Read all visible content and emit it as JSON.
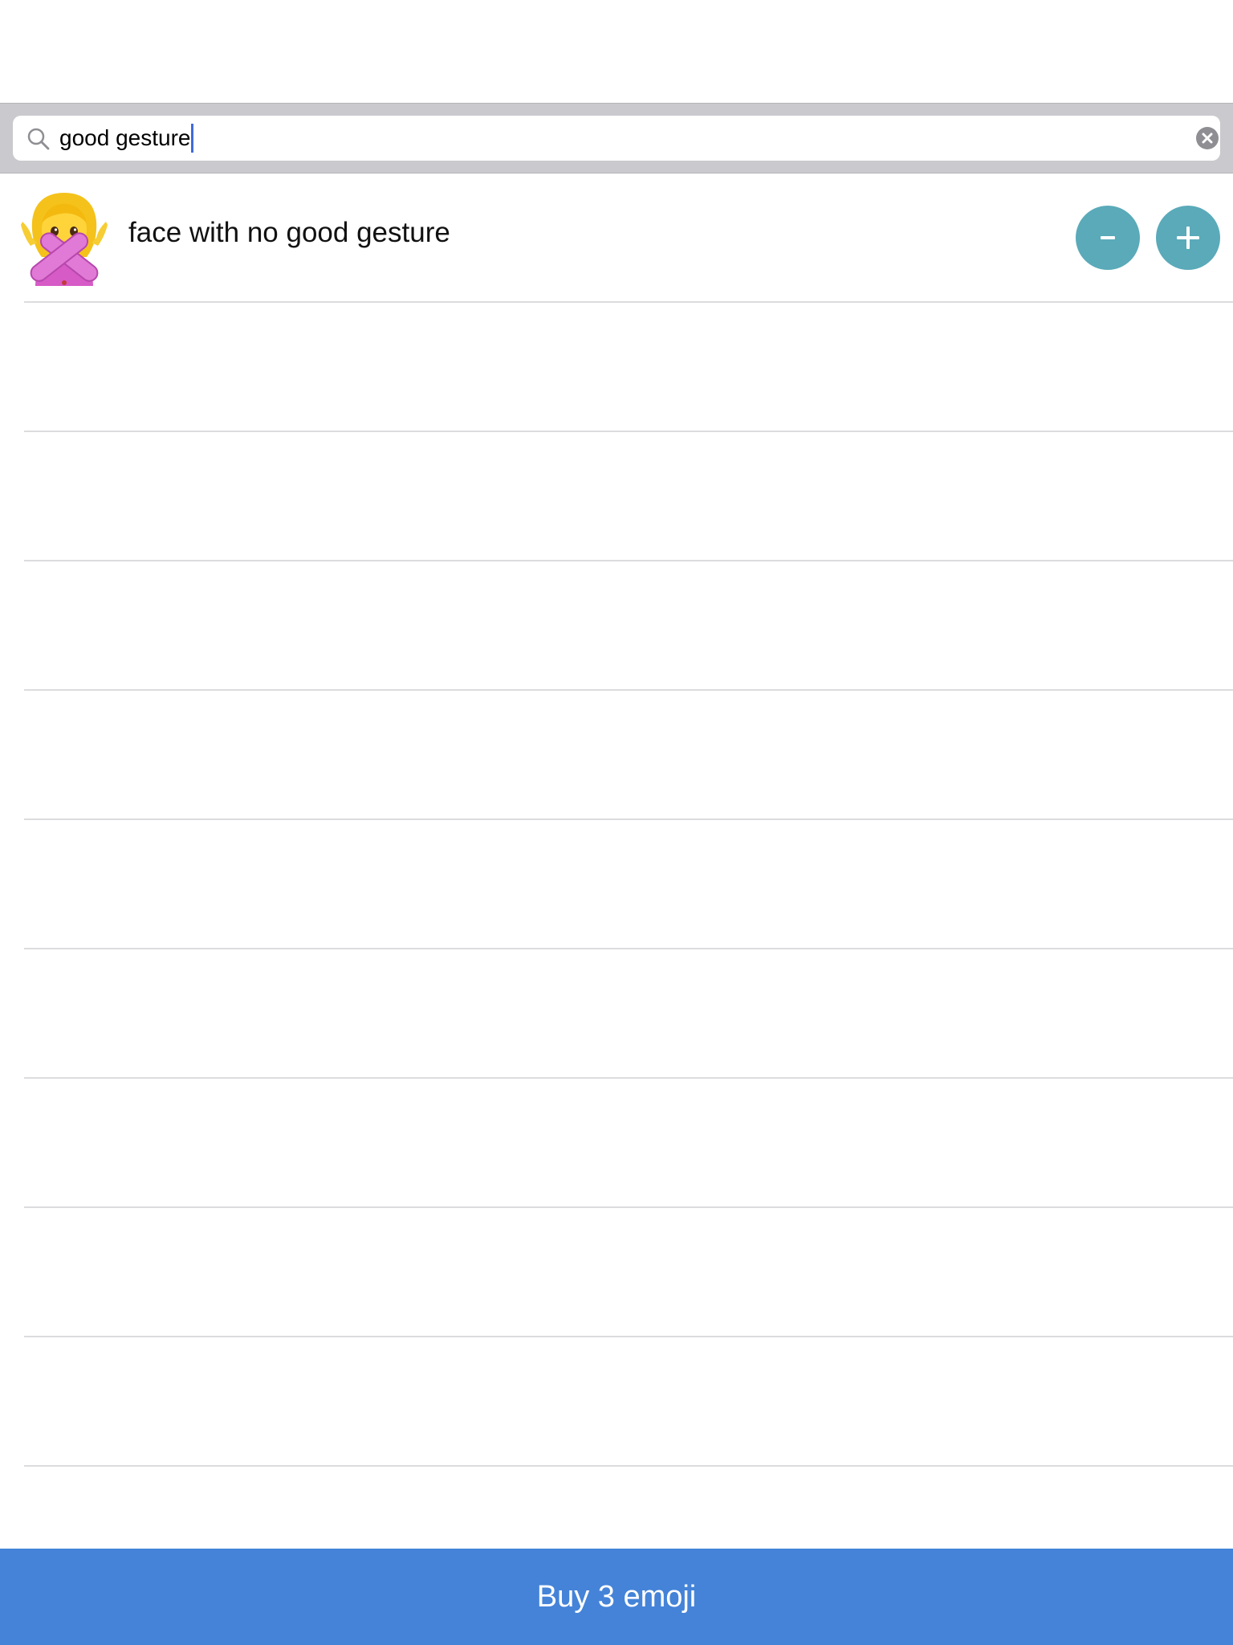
{
  "search": {
    "query": "good gesture"
  },
  "results": [
    {
      "emoji_icon": "face-with-no-good-gesture-emoji",
      "label": "face with no good gesture"
    }
  ],
  "empty_rows": 9,
  "buy_button": {
    "label": "Buy 3 emoji"
  },
  "colors": {
    "search_bar_bg": "#c9c9ce",
    "stepper_button": "#5aaab9",
    "buy_bar": "#4483d8",
    "caret": "#3f6bdc"
  }
}
